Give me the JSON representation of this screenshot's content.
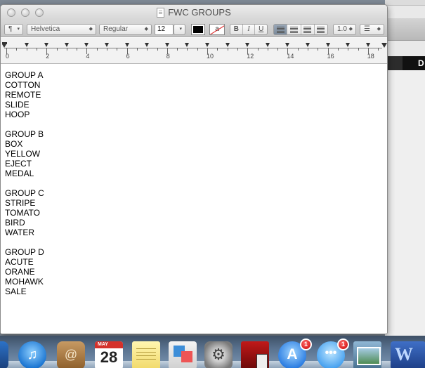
{
  "window": {
    "title": "FWC GROUPS"
  },
  "toolbar": {
    "paragraph_style": "¶",
    "font_family": "Helvetica",
    "font_style": "Regular",
    "font_size": "12",
    "highlight_glyph": "a",
    "bold": "B",
    "italic": "I",
    "underline": "U",
    "line_spacing": "1.0",
    "text_color": "#000000"
  },
  "ruler": {
    "labels": [
      "0",
      "2",
      "4",
      "6",
      "8",
      "10",
      "12",
      "14",
      "16",
      "18"
    ]
  },
  "document": {
    "lines": [
      "GROUP A",
      "COTTON",
      "REMOTE",
      "SLIDE",
      "HOOP",
      "",
      "GROUP B",
      "BOX",
      "YELLOW",
      "EJECT",
      "MEDAL",
      "",
      "GROUP C",
      "STRIPE",
      "TOMATO",
      "BIRD",
      "WATER",
      "",
      "GROUP D",
      "ACUTE",
      "ORANE",
      "MOHAWK",
      "SALE"
    ]
  },
  "background_window": {
    "header_letter": "D"
  },
  "dock": {
    "calendar_month": "MAY",
    "calendar_day": "28",
    "app_store_badge": "1",
    "messages_badge": "1",
    "icons": [
      "itunes-icon",
      "contacts-icon",
      "calendar-icon",
      "stickies-icon",
      "preview-icon",
      "system-preferences-icon",
      "photo-booth-icon",
      "app-store-icon",
      "messages-icon",
      "iphoto-icon",
      "word-icon"
    ]
  }
}
